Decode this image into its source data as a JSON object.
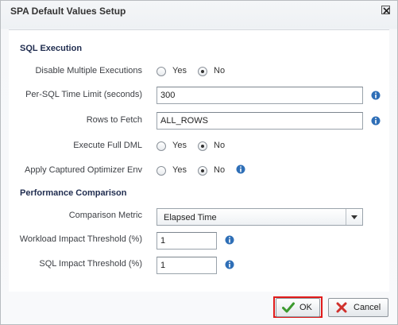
{
  "dialog": {
    "title": "SPA Default Values Setup",
    "close_icon": "close-icon"
  },
  "sections": {
    "sql_execution": "SQL Execution",
    "performance_comparison": "Performance Comparison"
  },
  "fields": {
    "disable_multiple_executions": {
      "label": "Disable Multiple Executions",
      "yes": "Yes",
      "no": "No",
      "selected": "No"
    },
    "per_sql_time_limit": {
      "label": "Per-SQL Time Limit (seconds)",
      "value": "300"
    },
    "rows_to_fetch": {
      "label": "Rows to Fetch",
      "value": "ALL_ROWS"
    },
    "execute_full_dml": {
      "label": "Execute Full DML",
      "yes": "Yes",
      "no": "No",
      "selected": "No"
    },
    "apply_captured_optimizer_env": {
      "label": "Apply Captured Optimizer Env",
      "yes": "Yes",
      "no": "No",
      "selected": "No"
    },
    "comparison_metric": {
      "label": "Comparison Metric",
      "value": "Elapsed Time"
    },
    "workload_impact_threshold": {
      "label": "Workload Impact Threshold (%)",
      "value": "1"
    },
    "sql_impact_threshold": {
      "label": "SQL Impact Threshold (%)",
      "value": "1"
    }
  },
  "buttons": {
    "ok": "OK",
    "cancel": "Cancel"
  },
  "colors": {
    "section_heading": "#1f2c4f",
    "focus_outline": "#e01b1b",
    "info_icon": "#2f6fb7",
    "ok_check": "#3c9a2e",
    "cancel_x": "#d0312d"
  }
}
